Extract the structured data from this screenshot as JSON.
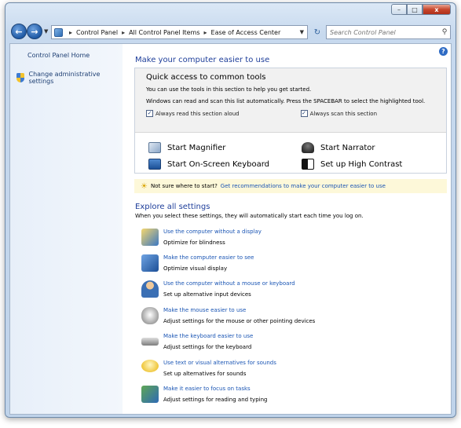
{
  "window": {
    "caption_buttons": {
      "minimize": "–",
      "maximize": "□",
      "close": "x"
    }
  },
  "navbar": {
    "back_icon": "back-arrow-icon",
    "forward_icon": "forward-arrow-icon",
    "breadcrumb": [
      "Control Panel",
      "All Control Panel Items",
      "Ease of Access Center"
    ],
    "search_placeholder": "Search Control Panel"
  },
  "sidebar": {
    "home_label": "Control Panel Home",
    "admin_label": "Change administrative settings"
  },
  "main": {
    "title": "Make your computer easier to use",
    "quick": {
      "title": "Quick access to common tools",
      "line1": "You can use the tools in this section to help you get started.",
      "line2": "Windows can read and scan this list automatically.  Press the SPACEBAR to select the highlighted tool.",
      "check1": "Always read this section aloud",
      "check2": "Always scan this section",
      "tools": [
        "Start Magnifier",
        "Start Narrator",
        "Start On-Screen Keyboard",
        "Set up High Contrast"
      ]
    },
    "tip": {
      "text": "Not sure where to start?",
      "link": "Get recommendations to make your computer easier to use"
    },
    "explore": {
      "title": "Explore all settings",
      "desc": "When you select these settings, they will automatically start each time you log on.",
      "items": [
        {
          "link": "Use the computer without a display",
          "desc": "Optimize for blindness"
        },
        {
          "link": "Make the computer easier to see",
          "desc": "Optimize visual display"
        },
        {
          "link": "Use the computer without a mouse or keyboard",
          "desc": "Set up alternative input devices"
        },
        {
          "link": "Make the mouse easier to use",
          "desc": "Adjust settings for the mouse or other pointing devices"
        },
        {
          "link": "Make the keyboard easier to use",
          "desc": "Adjust settings for the keyboard"
        },
        {
          "link": "Use text or visual alternatives for sounds",
          "desc": "Set up alternatives for sounds"
        },
        {
          "link": "Make it easier to focus on tasks",
          "desc": "Adjust settings for reading and typing"
        }
      ]
    }
  }
}
